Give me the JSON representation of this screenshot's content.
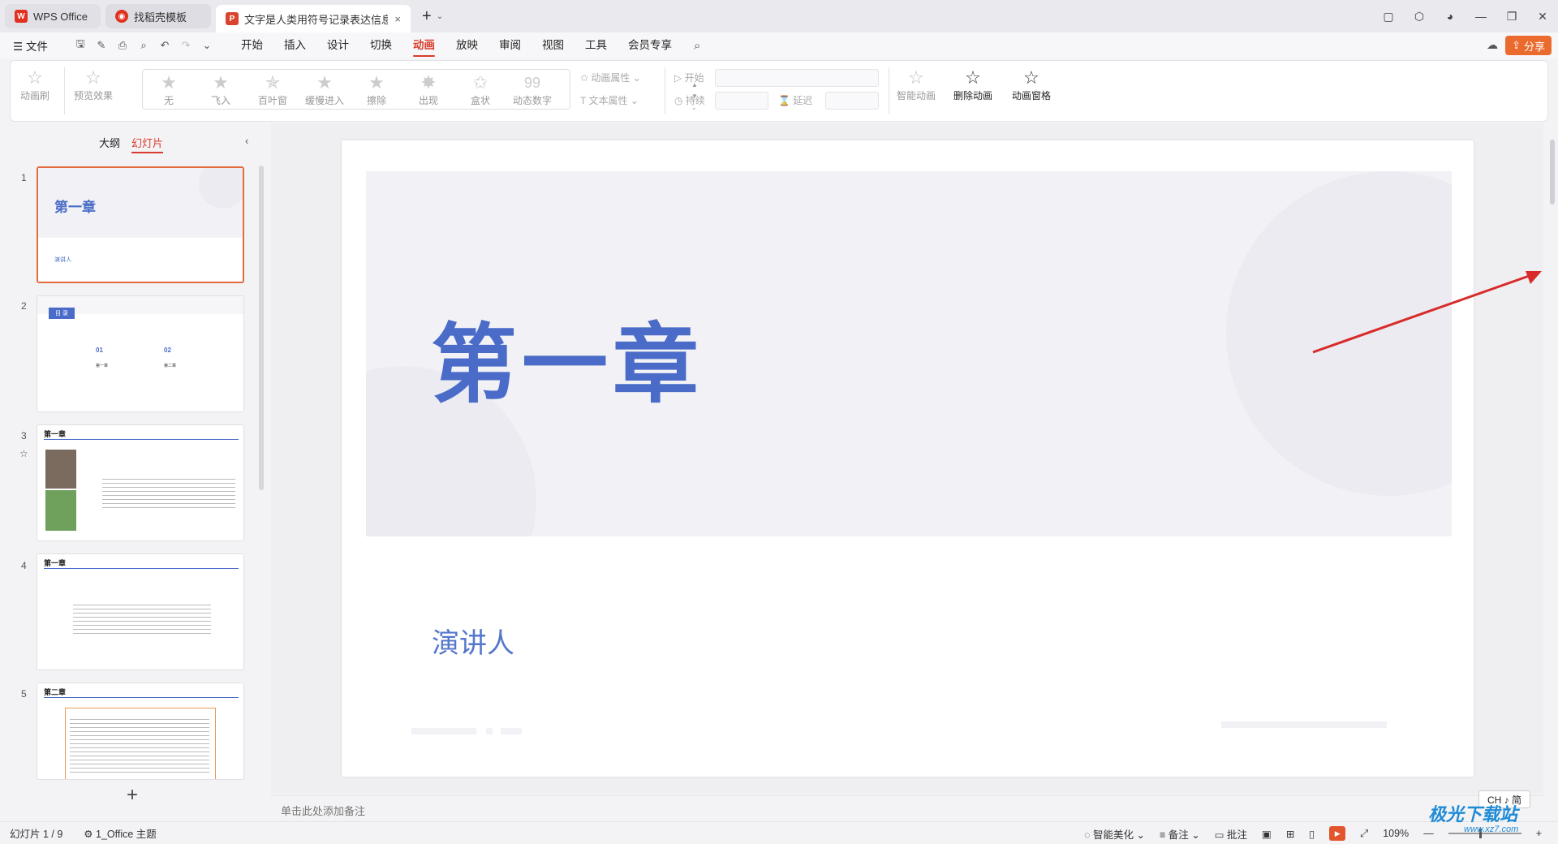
{
  "titlebar": {
    "home_tab": "WPS Office",
    "template_tab": "找稻壳模板",
    "doc_tab": "文字是人类用符号记录表达信息以",
    "close": "×",
    "new_tab": "+",
    "tab_list": "⌄"
  },
  "menubar": {
    "file": "文件",
    "menus": [
      "开始",
      "插入",
      "设计",
      "切换",
      "动画",
      "放映",
      "审阅",
      "视图",
      "工具",
      "会员专享"
    ],
    "active_menu": "动画",
    "share": "分享"
  },
  "ribbon": {
    "animation_brush": "动画刷",
    "preview_effect": "预览效果",
    "effects": [
      "无",
      "飞入",
      "百叶窗",
      "缓慢进入",
      "擦除",
      "出现",
      "盒状",
      "动态数字"
    ],
    "anim_props": "动画属性",
    "text_props": "文本属性",
    "start": "开始",
    "duration": "持续",
    "delay": "延迟",
    "smart_anim": "智能动画",
    "delete_anim": "删除动画",
    "anim_pane": "动画窗格"
  },
  "leftpanel": {
    "outline_tab": "大纲",
    "slides_tab": "幻灯片",
    "slides": [
      {
        "num": "1",
        "title": "第一章",
        "sub": "演讲人"
      },
      {
        "num": "2",
        "title": "目 录",
        "items": [
          "01",
          "02"
        ],
        "item_labels": [
          "第一章",
          "第二章"
        ]
      },
      {
        "num": "3",
        "title": "第一章"
      },
      {
        "num": "4",
        "title": "第一章"
      },
      {
        "num": "5",
        "title": "第二章"
      }
    ]
  },
  "slide": {
    "title": "第一章",
    "presenter": "演讲人"
  },
  "notes_placeholder": "单击此处添加备注",
  "statusbar": {
    "slide_counter": "幻灯片 1 / 9",
    "theme": "1_Office 主题",
    "smart_beautify": "智能美化",
    "notes": "备注",
    "comments": "批注",
    "zoom": "109%"
  },
  "ime": "CH ♪ 简",
  "watermark": {
    "main": "极光下载站",
    "url": "www.xz7.com"
  },
  "colors": {
    "accent": "#d83b2b",
    "slide_title": "#4a6cc8",
    "share": "#ea6b2d",
    "arrow": "#d92a2a"
  }
}
